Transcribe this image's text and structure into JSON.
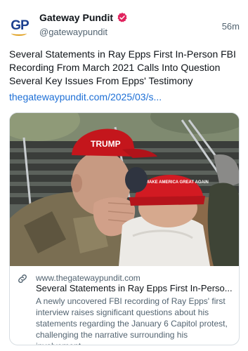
{
  "post": {
    "author_name": "Gateway Pundit",
    "handle": "@gatewaypundit",
    "time": "56m",
    "avatar_text": "GP",
    "text": "Several Statements in Ray Epps First In-Person FBI Recording From March 2021 Calls Into Question Several Key Issues From Epps' Testimony",
    "link_text": "thegatewaypundit.com/2025/03/s..."
  },
  "card": {
    "domain": "www.thegatewaypundit.com",
    "title": "Several Statements in Ray Epps First In-Perso...",
    "description": "A newly uncovered FBI recording of Ray Epps' first interview raises significant questions about his statements regarding the January 6 Capitol protest, challenging the narrative surrounding his involvement...",
    "hat1_text": "TRUMP",
    "hat2_text": "MAKE AMERICA GREAT AGAIN"
  },
  "icons": {
    "verified": "verified-badge-icon",
    "link": "link-icon"
  },
  "colors": {
    "accent_link": "#1d6fd6",
    "verified_badge": "#e0245e",
    "brand_blue": "#1b3f8f"
  }
}
